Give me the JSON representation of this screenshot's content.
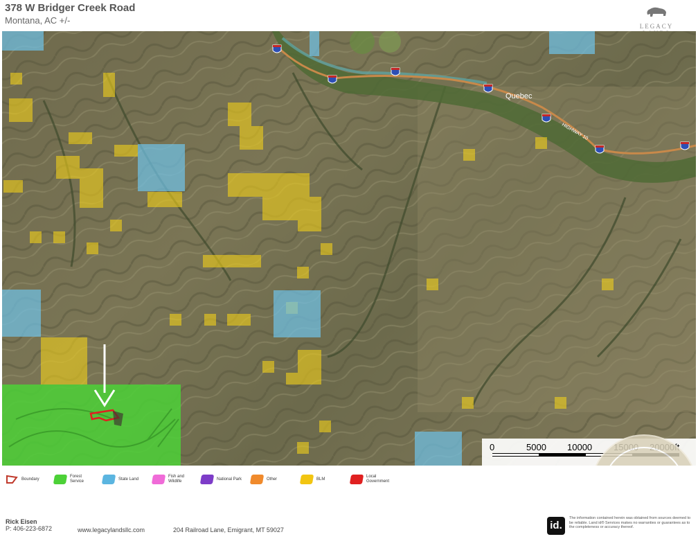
{
  "header": {
    "title": "378 W Bridger Creek Road",
    "subtitle": "Montana,  AC +/-",
    "brand": "LEGACY LANDS"
  },
  "map": {
    "place_label": "Quebec",
    "highway_label": "HIGHWAY 10",
    "interstate_shield": "90",
    "scale_labels": [
      "0",
      "5000",
      "10000",
      "15000",
      "20000ft"
    ]
  },
  "legend": [
    {
      "label": "Boundary",
      "color": "#c0392b",
      "icon": "boundary-outline-icon"
    },
    {
      "label": "Forest Service",
      "color": "#4cd137"
    },
    {
      "label": "State Land",
      "color": "#5bb5e0"
    },
    {
      "label": "Fish and Wildlife",
      "color": "#f06bd8"
    },
    {
      "label": "National Park",
      "color": "#7d3cc8"
    },
    {
      "label": "Other",
      "color": "#f08a2c"
    },
    {
      "label": "BLM",
      "color": "#f2c511"
    },
    {
      "label": "Local Government",
      "color": "#e02020"
    }
  ],
  "footer": {
    "agent_name": "Rick Eisen",
    "phone": "P: 406-223-6872",
    "website": "www.legacylandsllc.com",
    "address": "204 Railroad Lane, Emigrant, MT 59027",
    "id_logo": "id.",
    "disclaimer": "The information contained herein was obtained from sources deemed to be reliable. Land id® Services makes no warranties or guarantees as to the completeness or accuracy thereof."
  }
}
